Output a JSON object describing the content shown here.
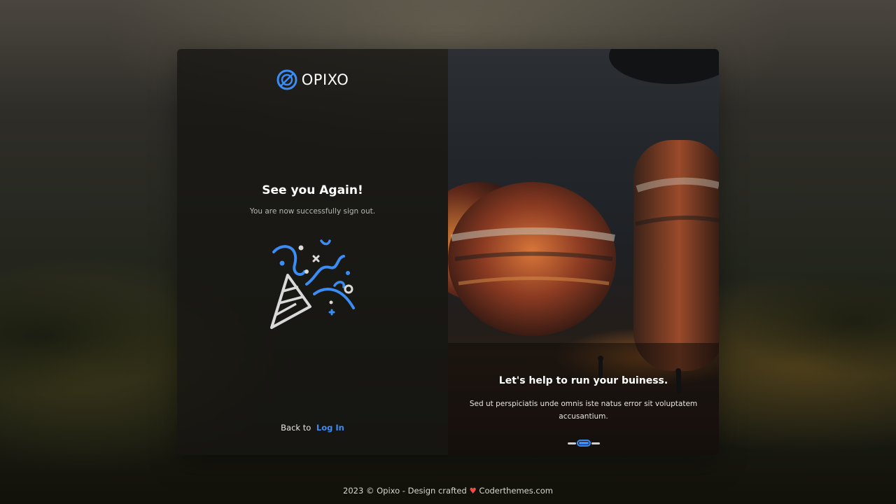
{
  "brand": {
    "name": "OPIXO",
    "logo_icon": "opixo-logo-icon",
    "accent": "#3b8df5"
  },
  "signout": {
    "title": "See you Again!",
    "message": "You are now successfully sign out.",
    "illustration": "party-popper-icon"
  },
  "back": {
    "prefix": "Back to",
    "link_label": "Log In"
  },
  "carousel": {
    "title": "Let's help to run your buiness.",
    "text": "Sed ut perspiciatis unde omnis iste natus error sit voluptatem accusantium.",
    "slide_count": 3,
    "active_slide": 2
  },
  "footer": {
    "prefix": "2023 © Opixo - Design crafted",
    "heart_icon": "heart-icon",
    "heart_color": "#ef4b4b",
    "credit": "Coderthemes.com"
  }
}
